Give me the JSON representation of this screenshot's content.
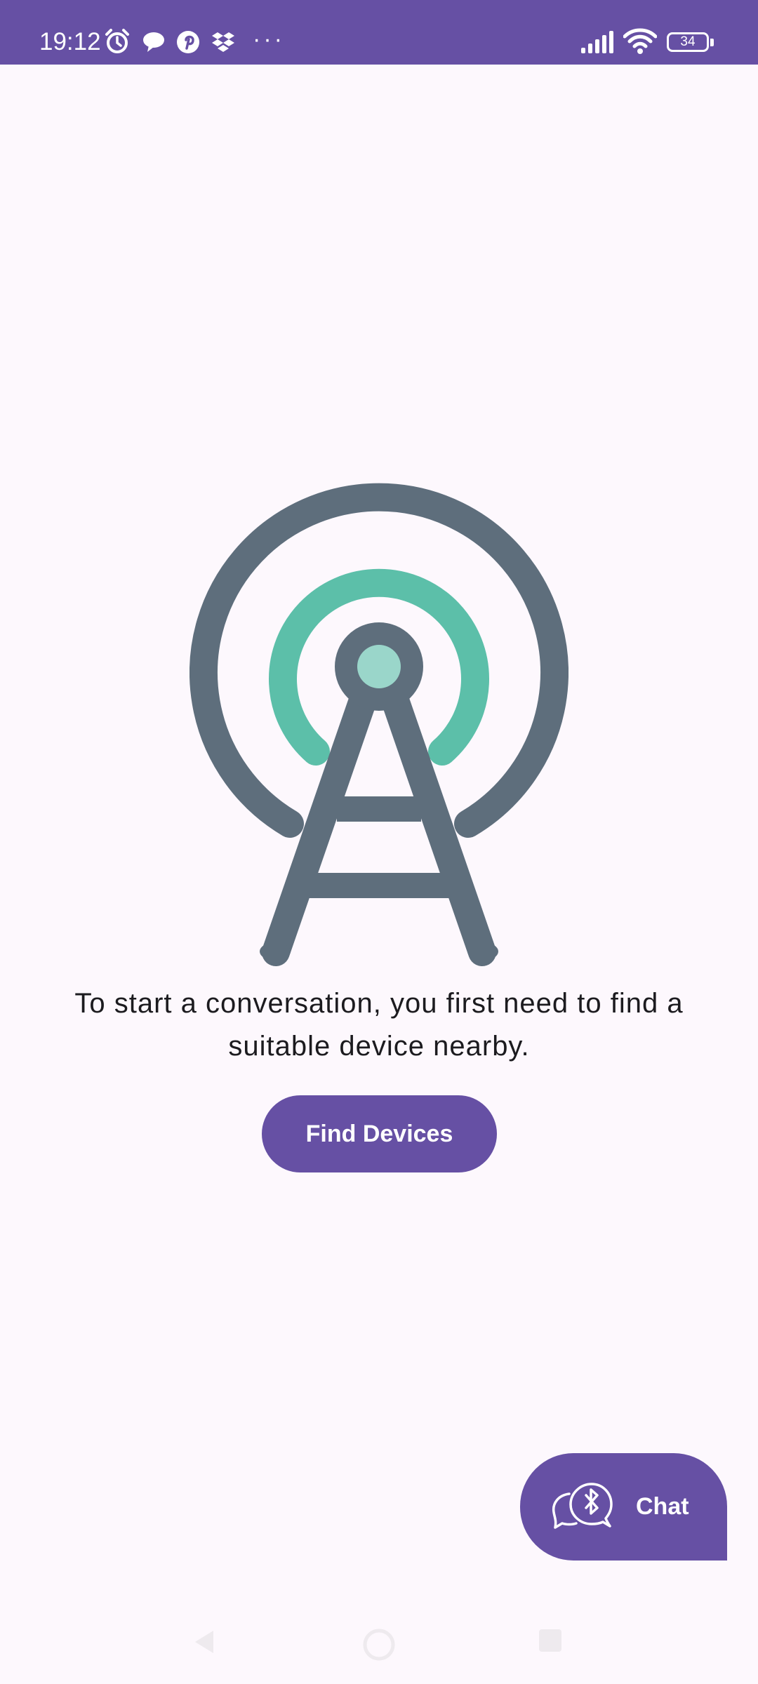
{
  "status_bar": {
    "time": "19:12",
    "battery_level": "34",
    "notification_icons": [
      "alarm-icon",
      "chat-bubble-icon",
      "pinterest-icon",
      "dropbox-icon",
      "more-dots-icon"
    ],
    "system_icons": [
      "signal-icon",
      "wifi-icon",
      "battery-icon"
    ],
    "more_indicator": "···",
    "background_color": "#6650a4"
  },
  "main": {
    "illustration": "radio-tower-icon",
    "message": "To start a conversation, you first need to find a suitable device nearby.",
    "find_button_label": "Find Devices"
  },
  "fab": {
    "icon": "bluetooth-chat-icon",
    "label": "Chat"
  },
  "colors": {
    "accent": "#6650a4",
    "tower": "#5e6e7c",
    "signal": "#5cbfa9",
    "signal_light": "#9ad6ca",
    "background": "#fdf8fd"
  }
}
